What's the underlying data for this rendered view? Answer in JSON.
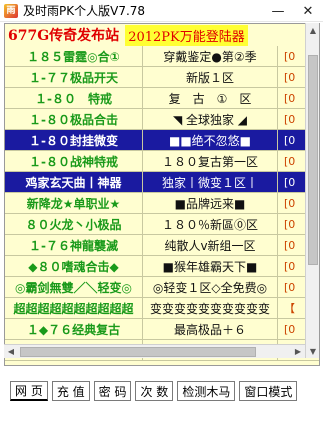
{
  "window": {
    "title": "及时雨PK个人版V7.78",
    "minimize_glyph": "—",
    "close_glyph": "✕"
  },
  "header": {
    "site_title": "677G传奇发布站",
    "badge": "2012PK万能登陆器"
  },
  "servers": [
    {
      "name": "１８５雷霆◎合①",
      "desc": "穿戴鉴定●第②季",
      "extra": "[0"
    },
    {
      "name": "１-７７极品开天",
      "desc": "新版１区",
      "extra": "[0"
    },
    {
      "name": "１-８０　特戒",
      "desc": "复　古　①　区",
      "extra": "[0"
    },
    {
      "name": "１-８０极品合击",
      "desc": "◥ 全球独家 ◢",
      "extra": "[0"
    },
    {
      "name": "１-８０封挂微变",
      "desc": "■■绝不忽悠■",
      "extra": "[0",
      "selected": true
    },
    {
      "name": "１-８０战神特戒",
      "desc": "１８０复古第一区",
      "extra": "[0"
    },
    {
      "name": "鸡家玄天曲丨神器",
      "desc": "独家丨微变１区丨",
      "extra": "[0",
      "selected": true
    },
    {
      "name": "新降龙★单职业★",
      "desc": "■品牌远来■",
      "extra": "[0"
    },
    {
      "name": "８０火龙丶小极品",
      "desc": "１８０％新區⓪区",
      "extra": "[0"
    },
    {
      "name": "１-７６神龍襲滅",
      "desc": "纯散人ⅴ新组一区",
      "extra": "[0"
    },
    {
      "name": "◆８０嗜魂合击◆",
      "desc": "■猴年雄霸天下■",
      "extra": "[0"
    },
    {
      "name": "◎霸剑無雙／＼轻变◎",
      "desc": "◎轻变１区◇全免费◎",
      "extra": "[0"
    },
    {
      "name": "超超超超超超超超超超",
      "desc": "变变变变变变变变变变",
      "extra": "【"
    },
    {
      "name": "１◆７６经典复古",
      "desc": "最高极品＋６",
      "extra": "[0"
    },
    {
      "name": "【龍魔弑天】微变",
      "desc": "全天新区开放不断",
      "extra": "【"
    }
  ],
  "tabs": [
    "网 页",
    "充 值",
    "密 码",
    "次 数",
    "检测木马",
    "窗口模式"
  ]
}
